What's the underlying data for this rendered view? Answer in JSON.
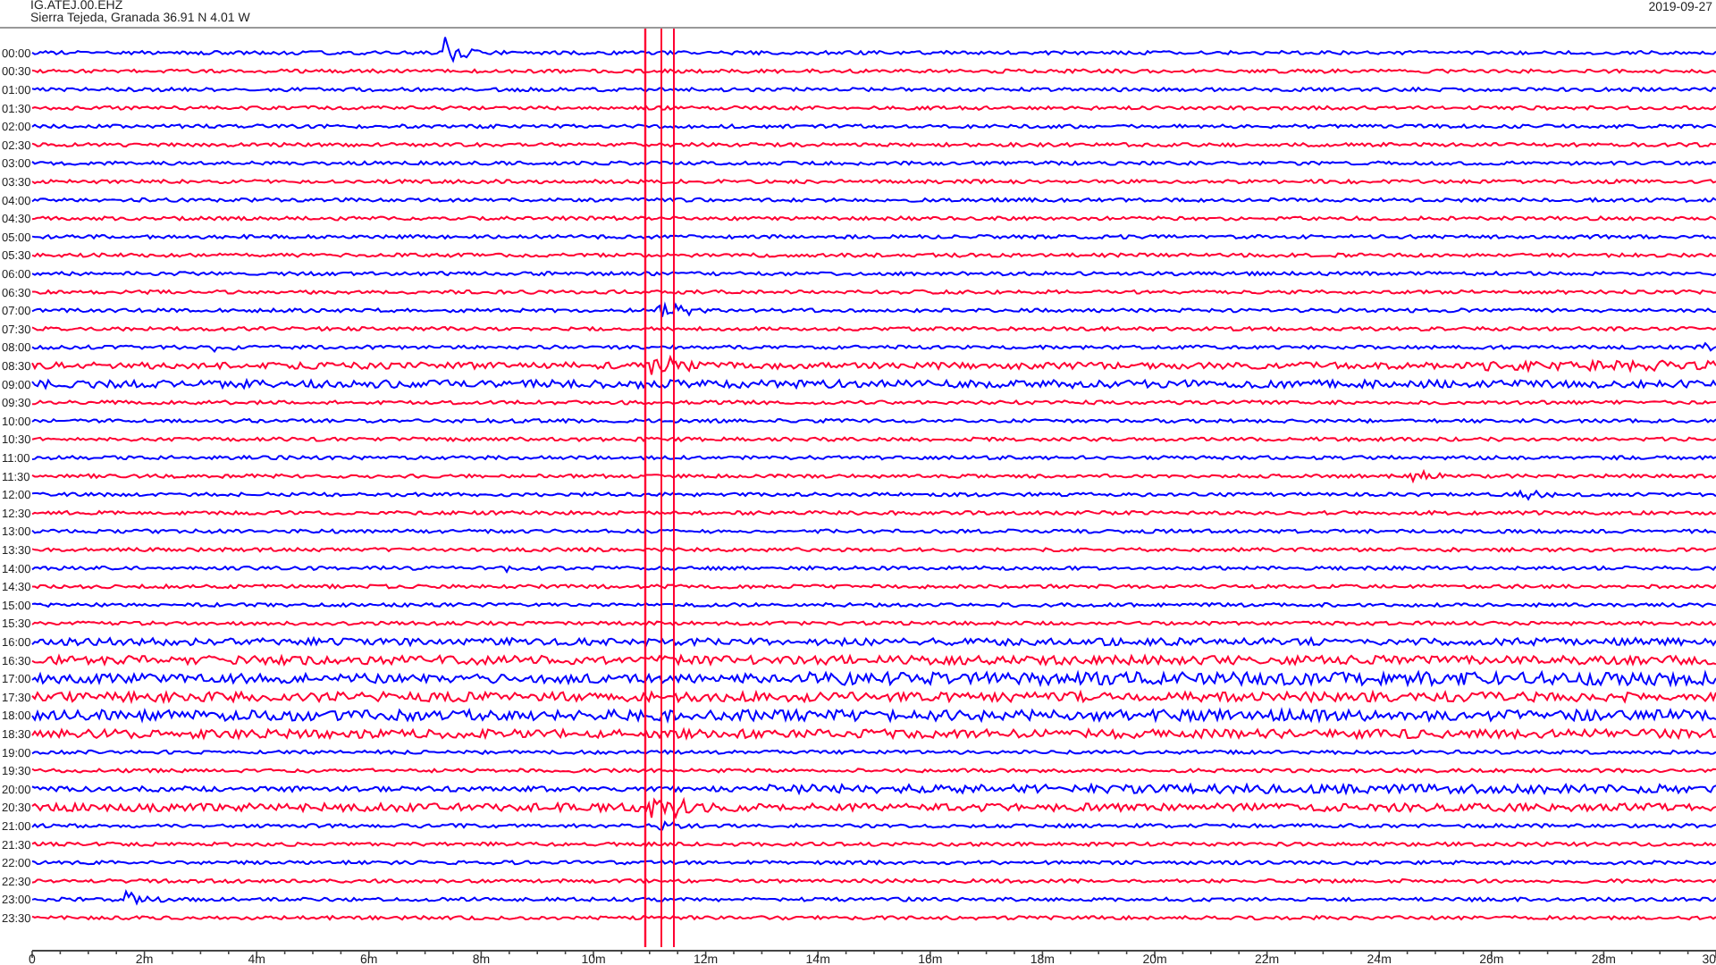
{
  "station": {
    "code": "IG.ATEJ.00.EHZ",
    "location": "Sierra Tejeda, Granada  36.91 N 4.01 W"
  },
  "date": "2019-09-27",
  "rows": [
    {
      "label": "00:00",
      "color": "#0000ff"
    },
    {
      "label": "00:30",
      "color": "#ff0033"
    },
    {
      "label": "01:00",
      "color": "#0000ff"
    },
    {
      "label": "01:30",
      "color": "#ff0033"
    },
    {
      "label": "02:00",
      "color": "#0000ff"
    },
    {
      "label": "02:30",
      "color": "#ff0033"
    },
    {
      "label": "03:00",
      "color": "#0000ff"
    },
    {
      "label": "03:30",
      "color": "#ff0033"
    },
    {
      "label": "04:00",
      "color": "#0000ff"
    },
    {
      "label": "04:30",
      "color": "#ff0033"
    },
    {
      "label": "05:00",
      "color": "#0000ff"
    },
    {
      "label": "05:30",
      "color": "#ff0033"
    },
    {
      "label": "06:00",
      "color": "#0000ff"
    },
    {
      "label": "06:30",
      "color": "#ff0033"
    },
    {
      "label": "07:00",
      "color": "#0000ff"
    },
    {
      "label": "07:30",
      "color": "#ff0033"
    },
    {
      "label": "08:00",
      "color": "#0000ff"
    },
    {
      "label": "08:30",
      "color": "#ff0033"
    },
    {
      "label": "09:00",
      "color": "#0000ff"
    },
    {
      "label": "09:30",
      "color": "#ff0033"
    },
    {
      "label": "10:00",
      "color": "#0000ff"
    },
    {
      "label": "10:30",
      "color": "#ff0033"
    },
    {
      "label": "11:00",
      "color": "#0000ff"
    },
    {
      "label": "11:30",
      "color": "#ff0033"
    },
    {
      "label": "12:00",
      "color": "#0000ff"
    },
    {
      "label": "12:30",
      "color": "#ff0033"
    },
    {
      "label": "13:00",
      "color": "#0000ff"
    },
    {
      "label": "13:30",
      "color": "#ff0033"
    },
    {
      "label": "14:00",
      "color": "#0000ff"
    },
    {
      "label": "14:30",
      "color": "#ff0033"
    },
    {
      "label": "15:00",
      "color": "#0000ff"
    },
    {
      "label": "15:30",
      "color": "#ff0033"
    },
    {
      "label": "16:00",
      "color": "#0000ff"
    },
    {
      "label": "16:30",
      "color": "#ff0033"
    },
    {
      "label": "17:00",
      "color": "#0000ff"
    },
    {
      "label": "17:30",
      "color": "#ff0033"
    },
    {
      "label": "18:00",
      "color": "#0000ff"
    },
    {
      "label": "18:30",
      "color": "#ff0033"
    },
    {
      "label": "19:00",
      "color": "#0000ff"
    },
    {
      "label": "19:30",
      "color": "#ff0033"
    },
    {
      "label": "20:00",
      "color": "#0000ff"
    },
    {
      "label": "20:30",
      "color": "#ff0033"
    },
    {
      "label": "21:00",
      "color": "#0000ff"
    },
    {
      "label": "21:30",
      "color": "#ff0033"
    },
    {
      "label": "22:00",
      "color": "#0000ff"
    },
    {
      "label": "22:30",
      "color": "#ff0033"
    },
    {
      "label": "23:00",
      "color": "#0000ff"
    },
    {
      "label": "23:30",
      "color": "#ff0033"
    }
  ],
  "x_ticks": [
    "0",
    "2m",
    "4m",
    "6m",
    "8m",
    "10m",
    "12m",
    "14m",
    "16m",
    "18m",
    "20m",
    "22m",
    "24m",
    "26m",
    "28m",
    "30"
  ]
}
